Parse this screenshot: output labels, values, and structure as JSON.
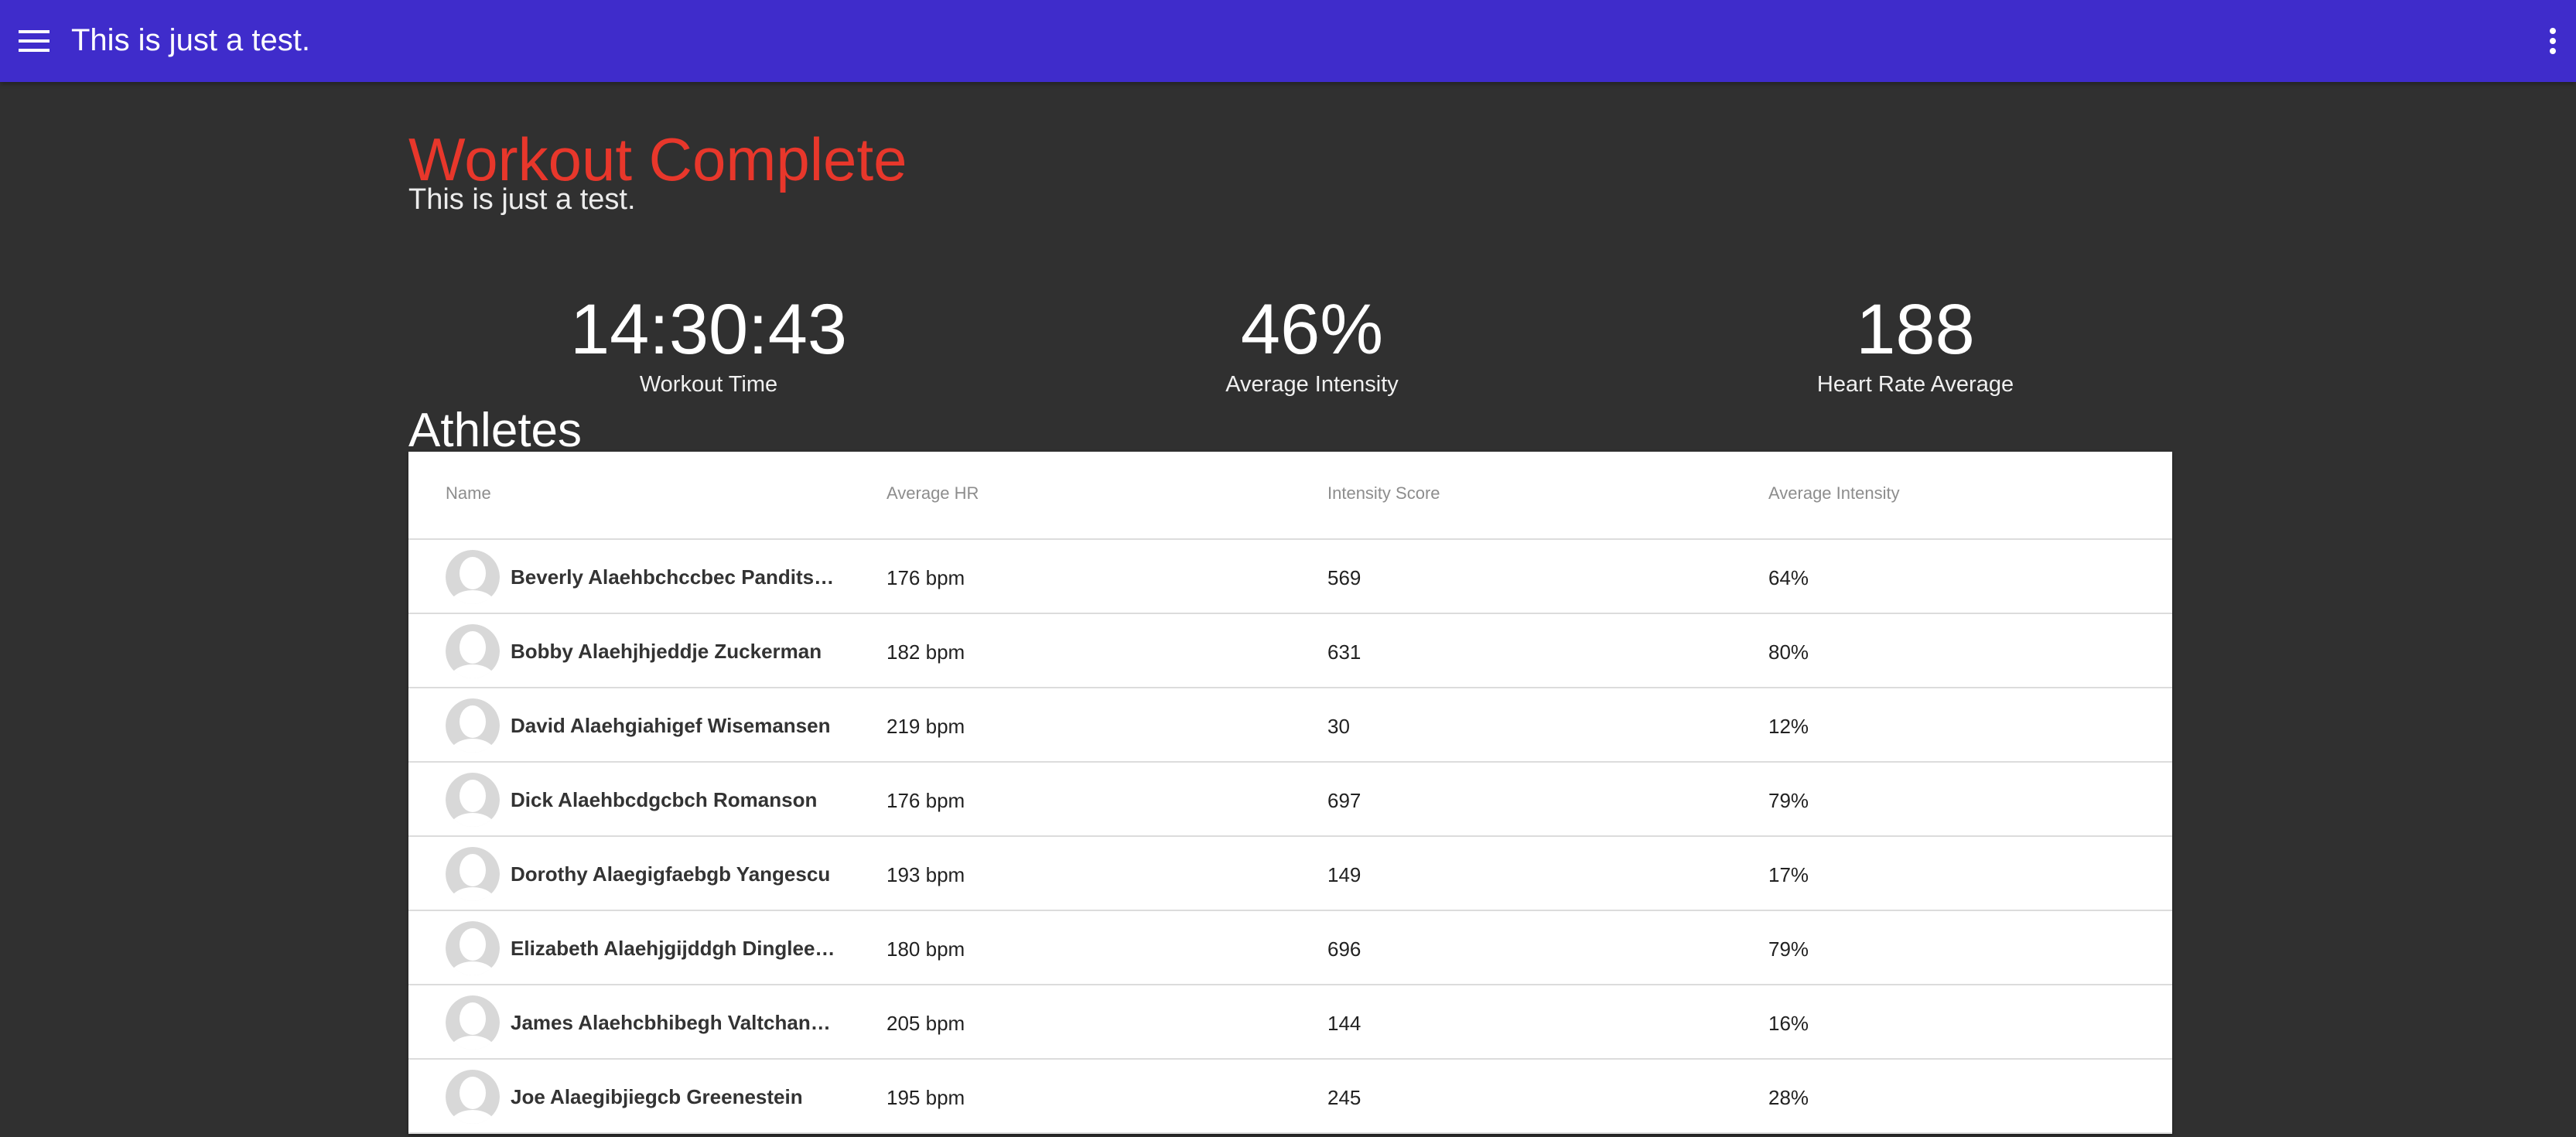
{
  "appbar": {
    "title": "This is just a test.",
    "menu_icon": "menu-icon",
    "more_icon": "more-vert-icon",
    "color": "#3f2ccb"
  },
  "workout": {
    "title": "Workout Complete",
    "subtitle": "This is just a test.",
    "title_color": "#e8372b"
  },
  "stats": {
    "time": {
      "value": "14:30:43",
      "label": "Workout Time"
    },
    "intensity": {
      "value": "46%",
      "label": "Average Intensity"
    },
    "heart_rate": {
      "value": "188",
      "label": "Heart Rate Average"
    }
  },
  "athletes": {
    "heading": "Athletes",
    "columns": [
      "Name",
      "Average HR",
      "Intensity Score",
      "Average Intensity"
    ],
    "rows": [
      {
        "name": "Beverly Alaehbchccbec Panditsonsky",
        "avg_hr": "176 bpm",
        "score": "569",
        "avg_intensity": "64%"
      },
      {
        "name": "Bobby Alaehjhjeddje Zuckerman",
        "avg_hr": "182 bpm",
        "score": "631",
        "avg_intensity": "80%"
      },
      {
        "name": "David Alaehgiahigef Wisemansen",
        "avg_hr": "219 bpm",
        "score": "30",
        "avg_intensity": "12%"
      },
      {
        "name": "Dick Alaehbcdgcbch Romanson",
        "avg_hr": "176 bpm",
        "score": "697",
        "avg_intensity": "79%"
      },
      {
        "name": "Dorothy Alaegigfaebgb Yangescu",
        "avg_hr": "193 bpm",
        "score": "149",
        "avg_intensity": "17%"
      },
      {
        "name": "Elizabeth Alaehjgijddgh Dingleeberg",
        "avg_hr": "180 bpm",
        "score": "696",
        "avg_intensity": "79%"
      },
      {
        "name": "James Alaehcbhibegh Valtchanowitz",
        "avg_hr": "205 bpm",
        "score": "144",
        "avg_intensity": "16%"
      },
      {
        "name": "Joe Alaegibjiegcb Greenestein",
        "avg_hr": "195 bpm",
        "score": "245",
        "avg_intensity": "28%"
      }
    ]
  }
}
